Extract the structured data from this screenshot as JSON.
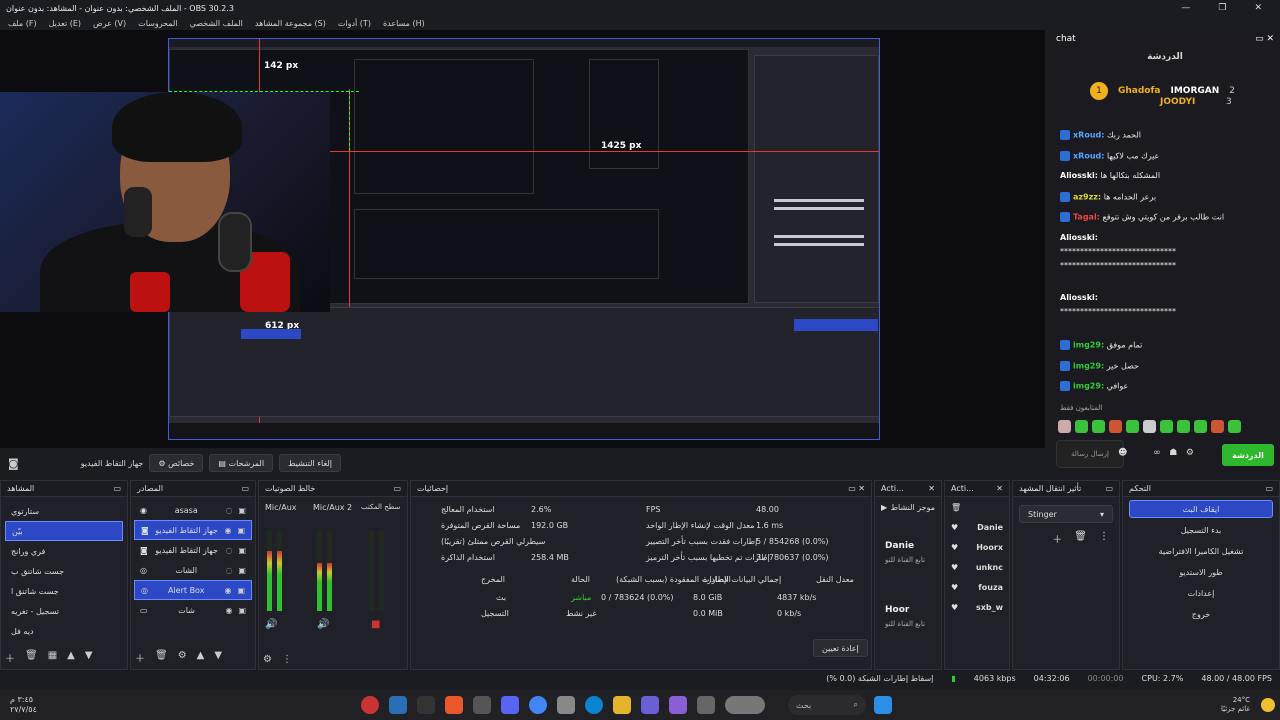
{
  "window": {
    "title": "الملف الشخصي: بدون عنوان - المشاهد: بدون عنوان - OBS 30.2.3",
    "controls": [
      "—",
      "❐",
      "✕"
    ]
  },
  "menu": [
    "ملف (F)",
    "تعديل (E)",
    "عرض (V)",
    "المحروسات",
    "الملف الشخصي",
    "مجموعة المشاهد (S)",
    "أدوات (T)",
    "مساعدة (H)"
  ],
  "preview": {
    "labels": [
      "142 px",
      "1425 px",
      "612 px"
    ]
  },
  "preview_toolbar": [
    "جهاز التقاط الفيديو",
    "خصائص",
    "المرشحات",
    "إلغاء التنشيط"
  ],
  "scenes": {
    "title": "المشاهد",
    "items": [
      "ستارتوي",
      "بيّن",
      "فري ورانج",
      "جست شاتنق ب",
      "جست شاتنق ا",
      "تسجيل - تغريه",
      "ديه فل"
    ],
    "selected_index": 1
  },
  "sources": {
    "title": "المصادر",
    "items": [
      "asasa",
      "جهاز التقاط الفيديو",
      "جهاز التقاط الفيديو",
      "الشات",
      "Alert Box",
      "شات"
    ],
    "selected_indices": [
      1,
      4
    ]
  },
  "audio": {
    "title": "خالط الصوتيات",
    "channels": [
      {
        "name": "Mic/Aux",
        "level": 0.75
      },
      {
        "name": "Mic/Aux 2",
        "level": 0.6
      },
      {
        "name": "سطح المكتب",
        "level": 0.0
      }
    ]
  },
  "stats": {
    "title": "إحصائيات",
    "left": [
      {
        "label": "استخدام المعالج",
        "value": "2.6%"
      },
      {
        "label": "مساحة القرص المتوفرة",
        "value": "192.0 GB"
      },
      {
        "label": "سيطرلي القرص ممتلئ (تقريبًا)",
        "value": ""
      },
      {
        "label": "استخدام الذاكرة",
        "value": "258.4 MB"
      }
    ],
    "right": [
      {
        "label": "FPS",
        "value": "48.00"
      },
      {
        "label": "معدل الوقت لإنشاء الإطار الواحد",
        "value": "1.6 ms"
      },
      {
        "label": "إطارات فقدت بسبب تأخر التصيير",
        "value": "5 / 854268 (0.0%)"
      },
      {
        "label": "إطارات تم تخطيها بسبب تأخر الترميز",
        "value": "3 / 780637 (0.0%)"
      }
    ],
    "table_headers": [
      "المخرج",
      "الحالة",
      "الإطارات المفقودة (بسبب الشبكة)",
      "إجمالي البيانات الصادرة",
      "معدل النقل"
    ],
    "table_rows": [
      [
        "بث",
        "مباشر",
        "0 / 783624 (0.0%)",
        "8.0 GiB",
        "4837 kb/s"
      ],
      [
        "التسجيل",
        "غير نشط",
        "",
        "0.0 MiB",
        "0 kb/s"
      ]
    ],
    "reset_label": "إعادة تعيين"
  },
  "actions1": {
    "title": "Acti...",
    "tab": "موجز النشاط",
    "items": [
      "Danie",
      "Hoor"
    ],
    "sub": [
      "تابع القناة للتو",
      "تابع القناة للتو"
    ]
  },
  "actions2": {
    "title": "Acti...",
    "items": [
      "Danie",
      "Hoorx",
      "unknc",
      "fouza",
      "sxb_w"
    ]
  },
  "transitions": {
    "title": "تأثير انتقال المشهد",
    "selected": "Stinger"
  },
  "controls": {
    "title": "التحكم",
    "buttons": [
      "ايقاف البث",
      "بدء التسجيل",
      "تشغيل الكاميرا الافتراضية",
      "طور الاستديو",
      "إعدادات",
      "خروج"
    ]
  },
  "chat": {
    "title": "chat",
    "header": "الدردشة",
    "top_users": [
      {
        "name": "Ghadofa",
        "rank": "1"
      },
      {
        "name": "IMORGAN",
        "rank": "2"
      },
      {
        "name": "JOODYI",
        "rank": "3"
      }
    ],
    "messages": [
      {
        "user": "xRoud:",
        "text": "الحمد ربك"
      },
      {
        "user": "xRoud:",
        "text": "عيرك مب لاكيها"
      },
      {
        "user": "Aliosski:",
        "text": "المشكله بتكالها ها"
      },
      {
        "user": "az9zz:",
        "text": "برعر الحدامه ها"
      },
      {
        "user": "Tagal:",
        "text": "انت طالب برقر من كويتي وش تتوقع"
      },
      {
        "user": "Aliosski:",
        "text": "*****************************"
      },
      {
        "user": "",
        "text": "*****************************"
      },
      {
        "user": "",
        "text": "*****************************"
      },
      {
        "user": "Aliosski:",
        "text": "*****************************"
      },
      {
        "user": "",
        "text": "*****************************"
      },
      {
        "user": "img29:",
        "text": "تمام موفق"
      },
      {
        "user": "img29:",
        "text": "حصل خير"
      },
      {
        "user": "img29:",
        "text": "عوافي"
      }
    ],
    "followers_label": "المتابعون فقط",
    "input_placeholder": "إرسال رسالة",
    "send_label": "الدردشة"
  },
  "statusbar": {
    "dropped": "إسقاط إطارات الشبكة (0.0 %)",
    "bitrate": "4063 kbps",
    "stream_time": "04:32:06",
    "rec_time": "00:00:00",
    "cpu": "CPU: 2.7%",
    "fps": "48.00 / 48.00 FPS"
  },
  "taskbar": {
    "search_placeholder": "بحث",
    "time": "٣:٤٥ م",
    "date": "٢٧/٧/٥٤",
    "weather_temp": "24°C",
    "weather_desc": "غائم جزئيًا"
  }
}
